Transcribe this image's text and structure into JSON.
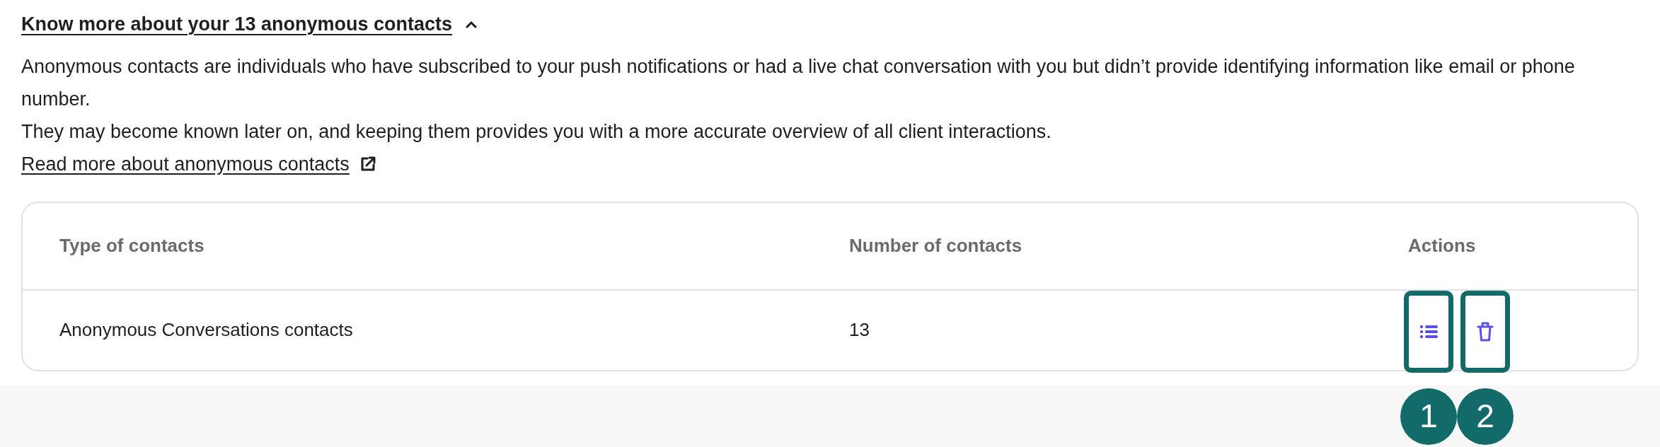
{
  "section": {
    "title": "Know more about your 13 anonymous contacts",
    "expanded": true,
    "paragraphs": [
      "Anonymous contacts are individuals who have subscribed to your push notifications or had a live chat conversation with you but didn’t provide identifying information like email or phone number.",
      "They may become known later on, and keeping them provides you with a more accurate overview of all client interactions."
    ],
    "link": "Read more about anonymous contacts"
  },
  "table": {
    "columns": [
      "Type of contacts",
      "Number of contacts",
      "Actions"
    ],
    "rows": [
      {
        "type": "Anonymous Conversations contacts",
        "count": "13",
        "actions": [
          {
            "kind": "list",
            "marker": "1"
          },
          {
            "kind": "delete",
            "marker": "2"
          }
        ]
      }
    ]
  }
}
